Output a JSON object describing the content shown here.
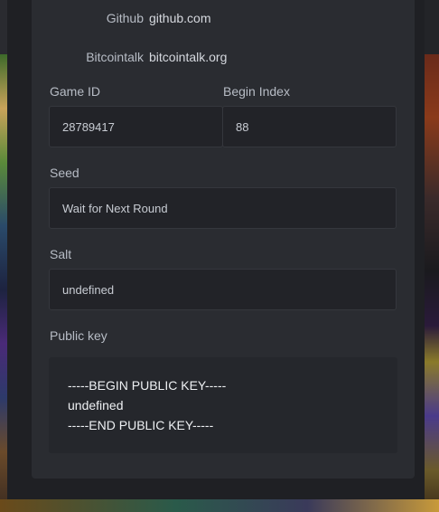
{
  "links": [
    {
      "label": "Github",
      "value": "github.com"
    },
    {
      "label": "Bitcointalk",
      "value": "bitcointalk.org"
    }
  ],
  "fields": {
    "game_id": {
      "label": "Game ID",
      "value": "28789417"
    },
    "begin_index": {
      "label": "Begin Index",
      "value": "88"
    },
    "seed": {
      "label": "Seed",
      "value": "Wait for Next Round"
    },
    "salt": {
      "label": "Salt",
      "value": "undefined"
    }
  },
  "public_key": {
    "label": "Public key",
    "lines": [
      "-----BEGIN PUBLIC KEY-----",
      "undefined",
      "-----END PUBLIC KEY-----"
    ]
  },
  "colors": {
    "panel": "#2a2c31",
    "field": "#222328",
    "label": "#b7bcc5"
  }
}
